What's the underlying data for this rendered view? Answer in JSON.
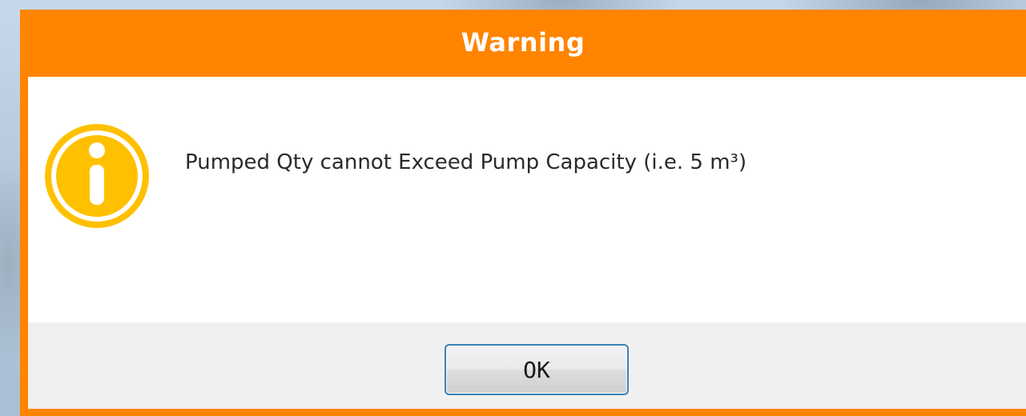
{
  "dialog": {
    "title": "Warning",
    "icon": "info-icon",
    "message": "Pumped Qty cannot Exceed Pump Capacity (i.e. 5 m³)",
    "ok_label": "OK"
  },
  "colors": {
    "frame": "#ff8400",
    "icon": "#ffc000",
    "button_border": "#3c7fb1"
  }
}
